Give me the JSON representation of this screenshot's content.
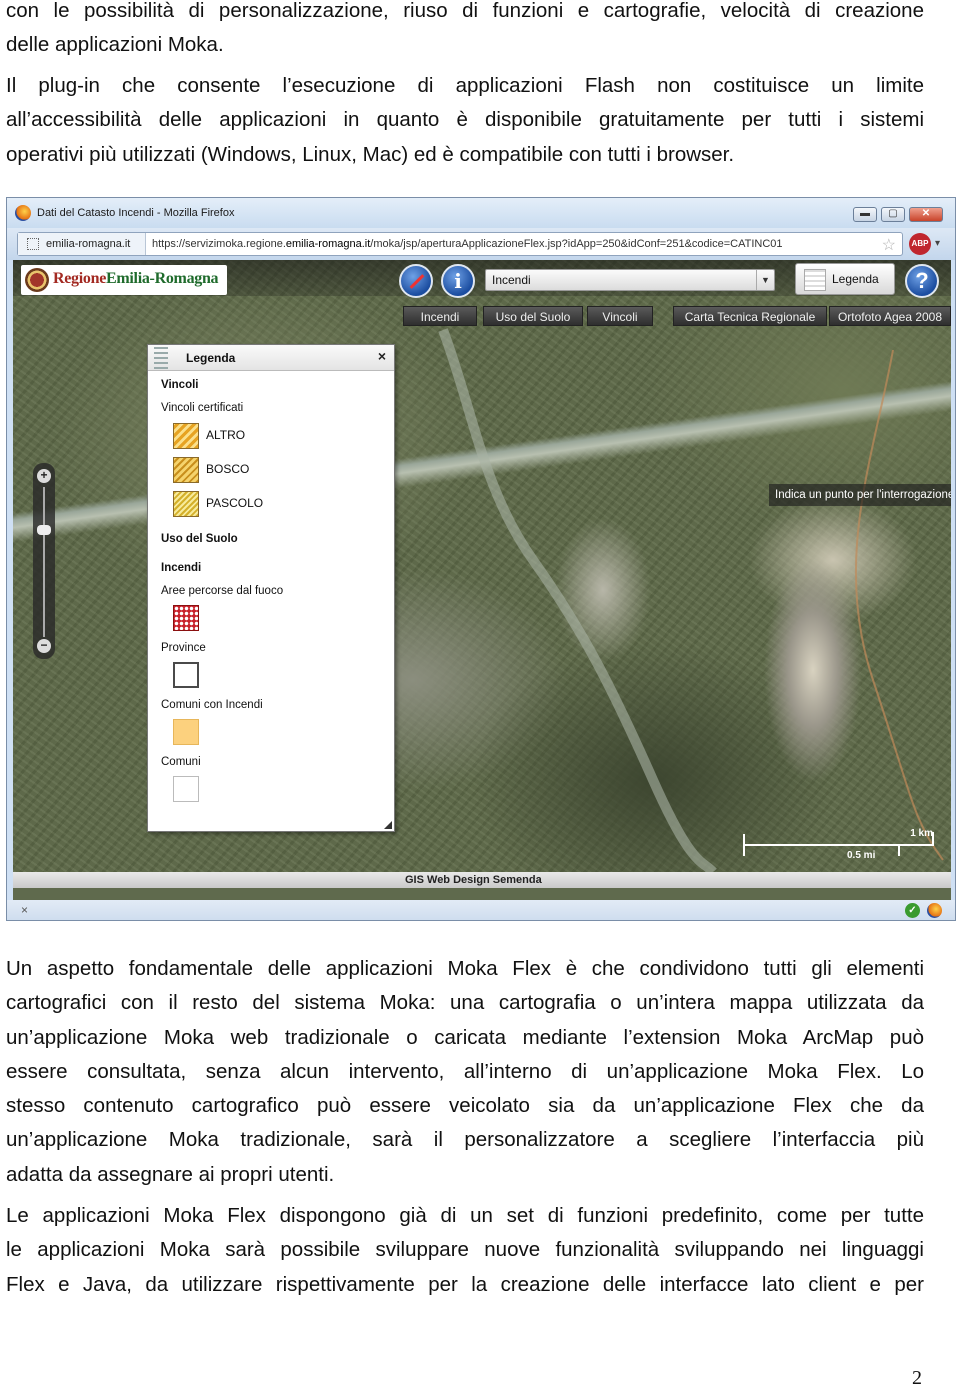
{
  "paragraphs_top": [
    {
      "lines": [
        "con le possibilità di personalizzazione, riuso di funzioni e cartografie, velocità di creazione",
        "delle applicazioni Moka."
      ]
    },
    {
      "lines": [
        "Il plug-in che consente l’esecuzione di applicazioni Flash non costituisce un limite",
        "all’accessibilità delle applicazioni in quanto è disponibile gratuitamente per tutti i sistemi",
        "operativi più utilizzati (Windows, Linux, Mac) ed è compatibile con tutti i browser."
      ]
    }
  ],
  "browser": {
    "title": "Dati del Catasto Incendi - Mozilla Firefox",
    "site_identity": "emilia-romagna.it",
    "url_prefix": "https://servizimoka.regione.",
    "url_domain": "emilia-romagna.it",
    "url_suffix": "/moka/jsp/aperturaApplicazioneFlex.jsp?idApp=250&idConf=251&codice=CATINC01",
    "buttons": {
      "minimize": "▬",
      "maximize": "▢",
      "close": "✕"
    },
    "abp_label": "ABP",
    "statusbar_close": "×",
    "ok_glyph": "✓"
  },
  "app": {
    "logo_prefix": "Regione",
    "logo_suffix": "Emilia-Romagna",
    "layer_select": "Incendi",
    "legend_button": "Legenda",
    "tabs": [
      "Incendi",
      "Uso del Suolo",
      "Vincoli",
      "Carta Tecnica Regionale",
      "Ortofoto Agea 2008"
    ],
    "hint": "Indica un punto per l'interrogazione",
    "scale_km": "1 km",
    "scale_mi": "0.5 mi",
    "footer": "GIS Web Design Semenda",
    "zoom_plus": "+",
    "zoom_minus": "−",
    "info_glyph": "i",
    "help_glyph": "?"
  },
  "legend": {
    "title": "Legenda",
    "close": "×",
    "vincoli": "Vincoli",
    "vincoli_certificati": "Vincoli certificati",
    "items_vincoli": [
      "ALTRO",
      "BOSCO",
      "PASCOLO"
    ],
    "uso_del_suolo": "Uso del Suolo",
    "incendi": "Incendi",
    "aree_percorse": "Aree percorse dal fuoco",
    "province": "Province",
    "comuni_con_incendi": "Comuni con Incendi",
    "comuni": "Comuni"
  },
  "paragraphs_bottom": [
    {
      "lines": [
        "Un aspetto fondamentale delle applicazioni Moka Flex è che condividono tutti gli elementi",
        "cartografici con il resto del sistema Moka: una cartografia o un’intera mappa utilizzata da",
        "un’applicazione Moka web tradizionale o caricata mediante l’extension Moka  ArcMap può",
        "essere consultata, senza alcun intervento, all’interno di un’applicazione Moka Flex. Lo",
        "stesso contenuto cartografico può essere veicolato sia da un’applicazione Flex che da",
        "un’applicazione Moka tradizionale, sarà il personalizzatore a scegliere l’interfaccia più",
        "adatta da assegnare ai propri utenti."
      ]
    },
    {
      "lines": [
        "Le applicazioni Moka Flex dispongono già di un set di funzioni predefinito, come per tutte",
        "le applicazioni Moka sarà possibile sviluppare nuove funzionalità sviluppando nei linguaggi",
        "Flex e Java, da utilizzare rispettivamente per la creazione delle interfacce lato client e per"
      ]
    }
  ],
  "page_number": "2"
}
